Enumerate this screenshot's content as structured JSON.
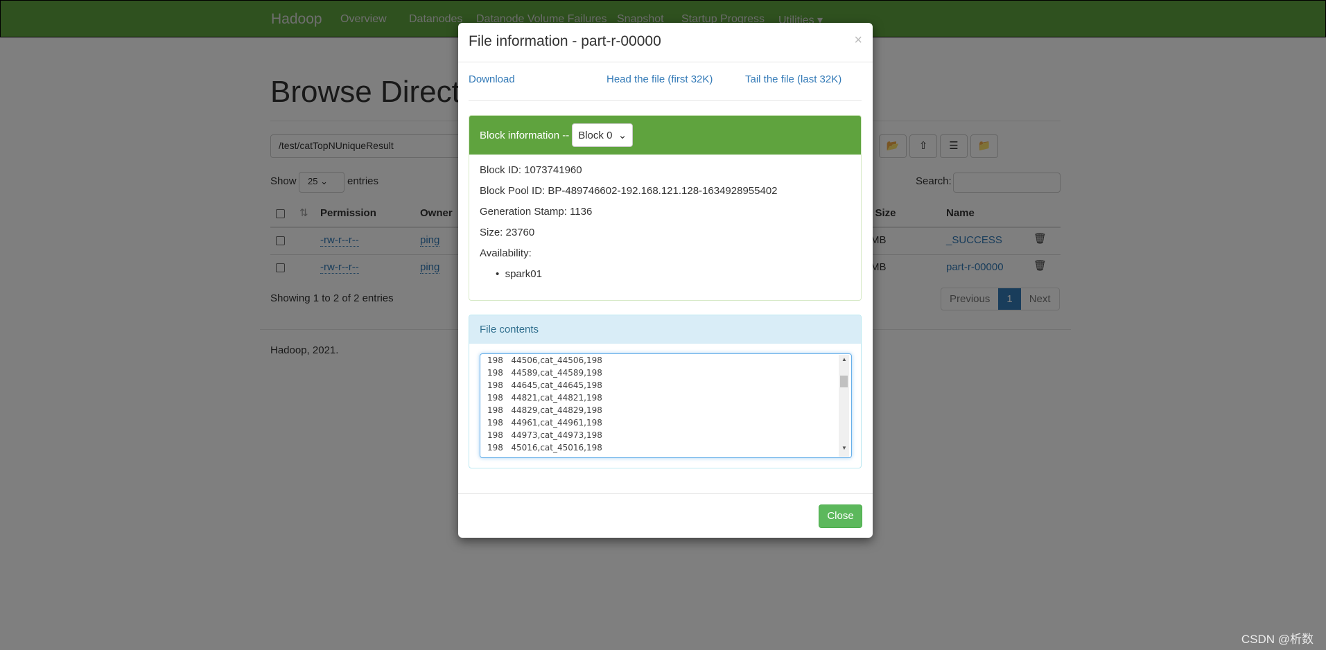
{
  "navbar": {
    "brand": "Hadoop",
    "items": [
      "Overview",
      "Datanodes",
      "Datanode Volume Failures",
      "Snapshot",
      "Startup Progress",
      "Utilities ▾"
    ]
  },
  "page": {
    "title": "Browse Directory",
    "path": "/test/catTopNUniqueResult",
    "show": "Show",
    "entries_count": "25",
    "entries": "entries",
    "search_label": "Search:",
    "info": "Showing 1 to 2 of 2 entries",
    "footer": "Hadoop, 2021.",
    "toolbar_icons": [
      "folder-open-icon",
      "cloud-upload-icon",
      "list-icon",
      "folder-upload-icon"
    ],
    "columns": [
      "Permission",
      "Owner",
      "k Size",
      "Name"
    ],
    "rows": [
      {
        "permission": "-rw-r--r--",
        "owner": "ping",
        "block_size": "MB",
        "name": "_SUCCESS"
      },
      {
        "permission": "-rw-r--r--",
        "owner": "ping",
        "block_size": "MB",
        "name": "part-r-00000"
      }
    ],
    "pager": {
      "prev": "Previous",
      "current": "1",
      "next": "Next"
    }
  },
  "modal": {
    "title": "File information - part-r-00000",
    "close_x": "×",
    "links": {
      "download": "Download",
      "head": "Head the file (first 32K)",
      "tail": "Tail the file (last 32K)"
    },
    "block": {
      "label": "Block information --",
      "selected": "Block 0",
      "id": "Block ID: 1073741960",
      "pool": "Block Pool ID: BP-489746602-192.168.121.128-1634928955402",
      "gen": "Generation Stamp: 1136",
      "size": "Size: 23760",
      "availability": "Availability:",
      "nodes": [
        "spark01"
      ]
    },
    "contents": {
      "label": "File contents",
      "lines": [
        "198\t44506,cat_44506,198",
        "198\t44589,cat_44589,198",
        "198\t44645,cat_44645,198",
        "198\t44821,cat_44821,198",
        "198\t44829,cat_44829,198",
        "198\t44961,cat_44961,198",
        "198\t44973,cat_44973,198",
        "198\t45016,cat_45016,198"
      ]
    },
    "close": "Close"
  },
  "colors": {
    "navbar": "#5fa33e",
    "block_header": "#5fa33e",
    "contents_header": "#d9edf7",
    "close_button": "#5cb85c",
    "link": "#337ab7"
  },
  "watermark": "CSDN @析数"
}
